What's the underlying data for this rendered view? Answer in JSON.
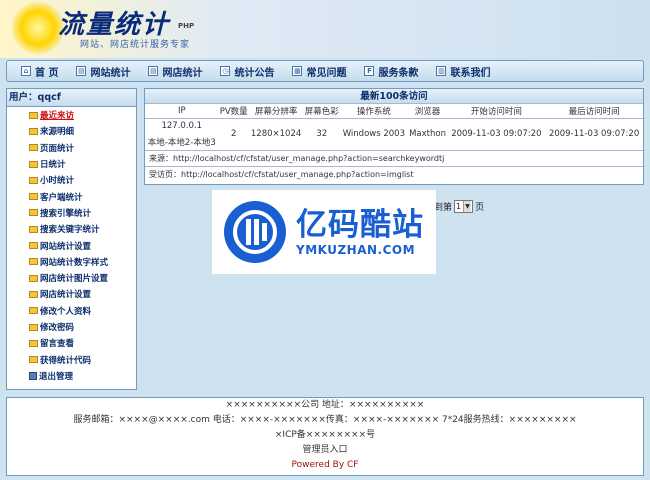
{
  "header": {
    "logo_text": "流量统计",
    "logo_php": "PHP",
    "slogan": "网站、网店统计服务专家"
  },
  "nav": [
    {
      "label": "首  页"
    },
    {
      "label": "网站统计"
    },
    {
      "label": "网店统计"
    },
    {
      "label": "统计公告"
    },
    {
      "label": "常见问题"
    },
    {
      "label": "服务条款"
    },
    {
      "label": "联系我们"
    }
  ],
  "sidebar": {
    "user_label": "用户：",
    "username": "qqcf",
    "items": [
      {
        "label": "最近来访",
        "active": true
      },
      {
        "label": "来源明细"
      },
      {
        "label": "页面统计"
      },
      {
        "label": "日统计"
      },
      {
        "label": "小时统计"
      },
      {
        "label": "客户端统计"
      },
      {
        "label": "搜索引擎统计"
      },
      {
        "label": "搜索关键字统计"
      },
      {
        "label": "网站统计设置"
      },
      {
        "label": "网站统计数字样式"
      },
      {
        "label": "网店统计图片设置"
      },
      {
        "label": "网店统计设置"
      },
      {
        "label": "修改个人资料"
      },
      {
        "label": "修改密码"
      },
      {
        "label": "留言查看"
      },
      {
        "label": "获得统计代码"
      },
      {
        "label": "退出管理"
      }
    ]
  },
  "main": {
    "title": "最新100条访问",
    "columns": [
      "IP",
      "PV数量",
      "屏幕分辨率",
      "屏幕色彩",
      "操作系统",
      "浏览器",
      "开始访问时间",
      "最后访问时间"
    ],
    "rows": [
      {
        "ip": "127.0.0.1",
        "location": "本地-本地2-本地3",
        "pv": "2",
        "resolution": "1280×1024",
        "color": "32",
        "os": "Windows 2003",
        "browser": "Maxthon",
        "start": "2009-11-03 09:07:20",
        "last": "2009-11-03 09:07:20"
      }
    ],
    "source_label": "来源：",
    "source_url": "http://localhost/cf/cfstat/user_manage.php?action=searchkeywordtj",
    "visited_label": "受访页：",
    "visited_url": "http://localhost/cf/cfstat/user_manage.php?action=imglist"
  },
  "pager": {
    "prefix": "到第",
    "page": "1",
    "suffix": "页"
  },
  "watermark": {
    "cn": "亿码酷站",
    "en": "YMKUZHAN.COM"
  },
  "footer": {
    "line1": "××××××××××公司 地址：××××××××××",
    "line2": "服务邮箱：××××@××××.com 电话：××××-×××××××传真：××××-××××××× 7*24服务热线：×××××××××",
    "line3": "×ICP备××××××××号",
    "admin": "管理员入口",
    "powered": "Powered By CF"
  },
  "colors": {
    "border": "#6f9bc4",
    "nav_text": "#0d2f6b",
    "active": "#d01010",
    "watermark_blue": "#1a5fd1"
  }
}
